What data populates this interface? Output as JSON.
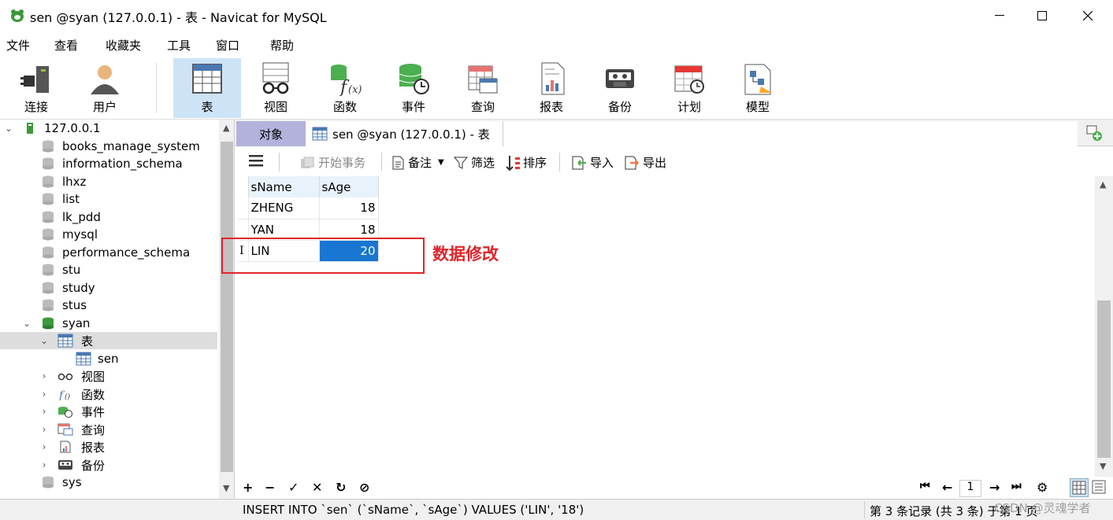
{
  "window": {
    "title": "sen @syan (127.0.0.1) - 表 - Navicat for MySQL"
  },
  "menu": [
    "文件",
    "查看",
    "收藏夹",
    "工具",
    "窗口",
    "帮助"
  ],
  "toolbar": [
    "连接",
    "用户",
    "表",
    "视图",
    "函数",
    "事件",
    "查询",
    "报表",
    "备份",
    "计划",
    "模型"
  ],
  "sidebar": {
    "connection": "127.0.0.1",
    "databases": [
      "books_manage_system",
      "information_schema",
      "lhxz",
      "list",
      "lk_pdd",
      "mysql",
      "performance_schema",
      "stu",
      "study",
      "stus"
    ],
    "open_db": "syan",
    "open_group": "表",
    "table": "sen",
    "groups": [
      "视图",
      "函数",
      "事件",
      "查询",
      "报表",
      "备份"
    ],
    "after": [
      "sys"
    ]
  },
  "tabs": {
    "objects": "对象",
    "doc": "sen @syan (127.0.0.1) - 表"
  },
  "subtoolbar": {
    "begin": "开始事务",
    "note": "备注",
    "filter": "筛选",
    "sort": "排序",
    "import": "导入",
    "export": "导出"
  },
  "table": {
    "columns": [
      "sName",
      "sAge"
    ],
    "rows": [
      [
        "ZHENG",
        "18"
      ],
      [
        "YAN",
        "18"
      ],
      [
        "LIN",
        "20"
      ]
    ]
  },
  "annotation": "数据修改",
  "pager": {
    "page": "1"
  },
  "status": {
    "sql": "INSERT INTO `sen` (`sName`, `sAge`) VALUES ('LIN', '18')",
    "record": "第 3 条记录 (共 3 条) 于第 1 页"
  },
  "watermark": "CSDN @灵魂学者",
  "colors": {
    "accent": "#1976d2",
    "annotation": "#e0252a",
    "tab_objects": "#b2b2dc"
  }
}
